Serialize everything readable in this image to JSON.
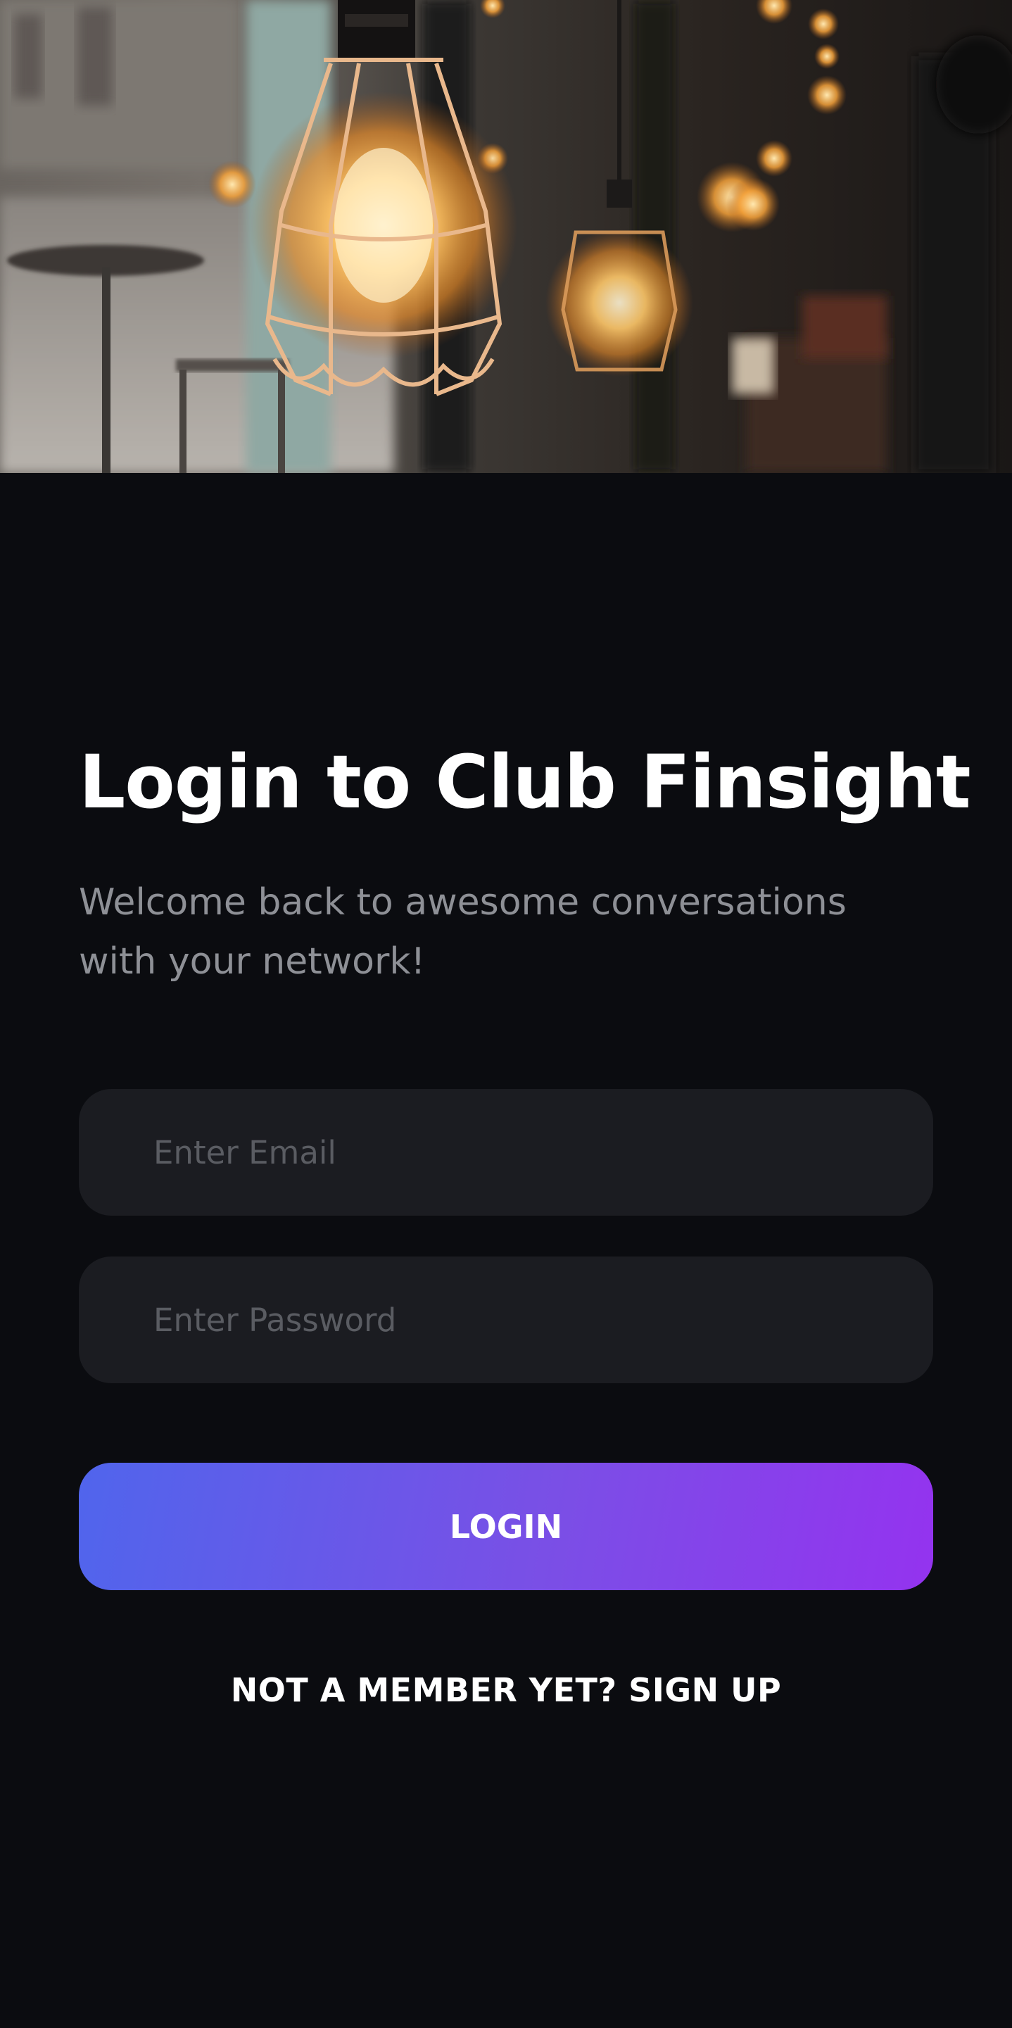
{
  "hero": {
    "image_icon": "pendant-lights-photo"
  },
  "login": {
    "title": "Login to Club Finsight",
    "subtitle": "Welcome back to awesome conversations with your network!",
    "email_placeholder": "Enter Email",
    "password_placeholder": "Enter Password",
    "login_label": "LOGIN",
    "signup_label": "NOT A MEMBER YET? SIGN UP"
  },
  "colors": {
    "background": "#0b0c10",
    "field_background": "#1b1c21",
    "button_gradient_start": "#5065ec",
    "button_gradient_end": "#9433ef",
    "subtitle_text": "#8e9096"
  }
}
